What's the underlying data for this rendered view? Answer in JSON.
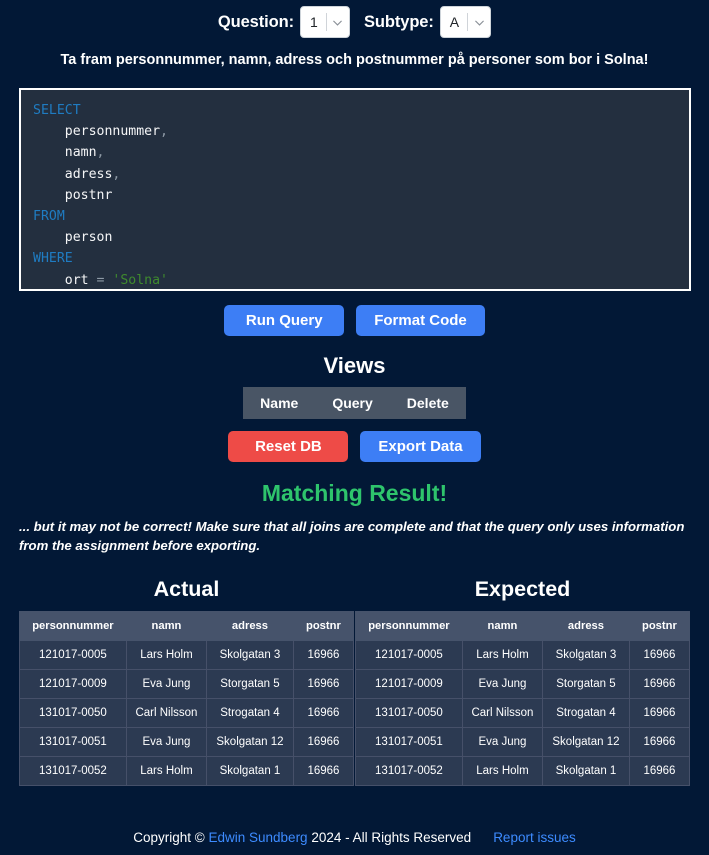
{
  "selectors": {
    "question": {
      "label": "Question:",
      "value": "1",
      "icon": "chevron-down-icon"
    },
    "subtype": {
      "label": "Subtype:",
      "value": "A",
      "icon": "chevron-down-icon"
    }
  },
  "question_text": "Ta fram personnummer, namn, adress och postnummer på personer som bor i Solna!",
  "editor": {
    "language": "sql",
    "lines": [
      {
        "tokens": [
          {
            "t": "SELECT",
            "c": "kw"
          }
        ]
      },
      {
        "tokens": [
          {
            "t": "    personnummer",
            "c": "id"
          },
          {
            "t": ",",
            "c": "pn"
          }
        ]
      },
      {
        "tokens": [
          {
            "t": "    namn",
            "c": "id"
          },
          {
            "t": ",",
            "c": "pn"
          }
        ]
      },
      {
        "tokens": [
          {
            "t": "    adress",
            "c": "id"
          },
          {
            "t": ",",
            "c": "pn"
          }
        ]
      },
      {
        "tokens": [
          {
            "t": "    postnr",
            "c": "id"
          }
        ]
      },
      {
        "tokens": [
          {
            "t": "FROM",
            "c": "kw"
          }
        ]
      },
      {
        "tokens": [
          {
            "t": "    person",
            "c": "id"
          }
        ]
      },
      {
        "tokens": [
          {
            "t": "WHERE",
            "c": "kw"
          }
        ]
      },
      {
        "tokens": [
          {
            "t": "    ort ",
            "c": "id"
          },
          {
            "t": "= ",
            "c": "op"
          },
          {
            "t": "'Solna'",
            "c": "str"
          }
        ]
      }
    ],
    "plain_text": "SELECT\n    personnummer,\n    namn,\n    adress,\n    postnr\nFROM\n    person\nWHERE\n    ort = 'Solna'"
  },
  "actions": {
    "run_query": "Run Query",
    "format_code": "Format Code",
    "reset_db": "Reset DB",
    "export_data": "Export Data"
  },
  "views": {
    "title": "Views",
    "columns": [
      "Name",
      "Query",
      "Delete"
    ],
    "rows": []
  },
  "result": {
    "status": "Matching Result!",
    "status_color": "#2ec46c",
    "note": "... but it may not be correct! Make sure that all joins are complete and that the query only uses information from the assignment before exporting."
  },
  "tables": {
    "actual": {
      "title": "Actual",
      "columns": [
        "personnummer",
        "namn",
        "adress",
        "postnr"
      ],
      "rows": [
        [
          "121017-0005",
          "Lars Holm",
          "Skolgatan 3",
          "16966"
        ],
        [
          "121017-0009",
          "Eva Jung",
          "Storgatan 5",
          "16966"
        ],
        [
          "131017-0050",
          "Carl Nilsson",
          "Strogatan 4",
          "16966"
        ],
        [
          "131017-0051",
          "Eva Jung",
          "Skolgatan 12",
          "16966"
        ],
        [
          "131017-0052",
          "Lars Holm",
          "Skolgatan 1",
          "16966"
        ]
      ]
    },
    "expected": {
      "title": "Expected",
      "columns": [
        "personnummer",
        "namn",
        "adress",
        "postnr"
      ],
      "rows": [
        [
          "121017-0005",
          "Lars Holm",
          "Skolgatan 3",
          "16966"
        ],
        [
          "121017-0009",
          "Eva Jung",
          "Storgatan 5",
          "16966"
        ],
        [
          "131017-0050",
          "Carl Nilsson",
          "Strogatan 4",
          "16966"
        ],
        [
          "131017-0051",
          "Eva Jung",
          "Skolgatan 12",
          "16966"
        ],
        [
          "131017-0052",
          "Lars Holm",
          "Skolgatan 1",
          "16966"
        ]
      ]
    }
  },
  "footer": {
    "copyright_prefix": "Copyright ©",
    "author": "Edwin Sundberg",
    "copyright_suffix": "2024 - All Rights Reserved",
    "report_link": "Report issues"
  },
  "colors": {
    "background": "#021836",
    "editor_background": "#232f3f",
    "accent_blue": "#3d7ef5",
    "danger_red": "#ee4b47",
    "success_green": "#2ec46c",
    "table_header": "#46536b",
    "table_row": "#2c3a52",
    "views_header": "#495565",
    "link": "#3d8bff"
  }
}
